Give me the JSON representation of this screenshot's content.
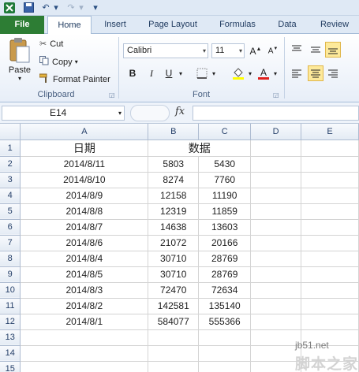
{
  "ribbon_tabs": {
    "file": "File",
    "home": "Home",
    "insert": "Insert",
    "page_layout": "Page Layout",
    "formulas": "Formulas",
    "data": "Data",
    "review": "Review"
  },
  "clipboard": {
    "paste": "Paste",
    "cut": "Cut",
    "copy": "Copy",
    "format_painter": "Format Painter",
    "group_label": "Clipboard"
  },
  "font": {
    "family": "Calibri",
    "size": "11",
    "bold": "B",
    "italic": "I",
    "underline": "U",
    "group_label": "Font"
  },
  "formula_bar": {
    "name_box": "E14",
    "fx": "fx"
  },
  "sheet": {
    "columns": [
      "A",
      "B",
      "C",
      "D",
      "E"
    ],
    "header_row": [
      "日期",
      "数据"
    ],
    "rows": [
      {
        "n": "1"
      },
      {
        "n": "2",
        "a": "2014/8/11",
        "b": "5803",
        "c": "5430"
      },
      {
        "n": "3",
        "a": "2014/8/10",
        "b": "8274",
        "c": "7760"
      },
      {
        "n": "4",
        "a": "2014/8/9",
        "b": "12158",
        "c": "11190"
      },
      {
        "n": "5",
        "a": "2014/8/8",
        "b": "12319",
        "c": "11859"
      },
      {
        "n": "6",
        "a": "2014/8/7",
        "b": "14638",
        "c": "13603"
      },
      {
        "n": "7",
        "a": "2014/8/6",
        "b": "21072",
        "c": "20166"
      },
      {
        "n": "8",
        "a": "2014/8/4",
        "b": "30710",
        "c": "28769"
      },
      {
        "n": "9",
        "a": "2014/8/5",
        "b": "30710",
        "c": "28769"
      },
      {
        "n": "10",
        "a": "2014/8/3",
        "b": "72470",
        "c": "72634"
      },
      {
        "n": "11",
        "a": "2014/8/2",
        "b": "142581",
        "c": "135140"
      },
      {
        "n": "12",
        "a": "2014/8/1",
        "b": "584077",
        "c": "555366"
      },
      {
        "n": "13"
      },
      {
        "n": "14"
      },
      {
        "n": "15"
      }
    ]
  },
  "watermark": {
    "site": "jb51.net",
    "brand": "脚本之家"
  }
}
